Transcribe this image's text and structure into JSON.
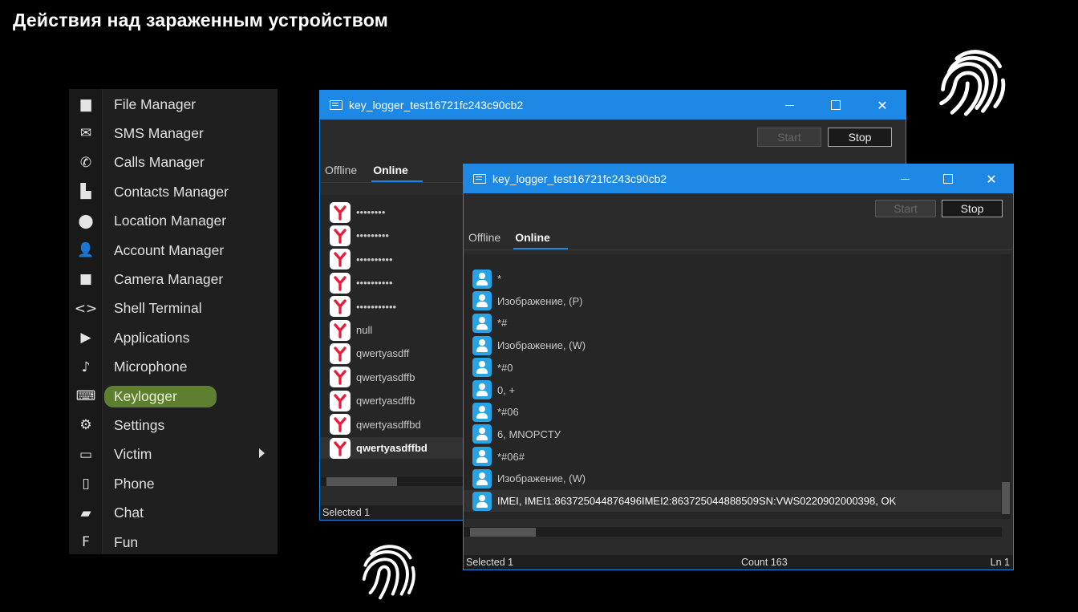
{
  "slide": {
    "title": "Действия над зараженным устройством"
  },
  "menu": {
    "items": [
      {
        "label": "File Manager",
        "icon": "folder-icon",
        "glyph": "▆"
      },
      {
        "label": "SMS Manager",
        "icon": "envelope-icon",
        "glyph": "✉"
      },
      {
        "label": "Calls Manager",
        "icon": "phone-handset-icon",
        "glyph": "✆"
      },
      {
        "label": "Contacts Manager",
        "icon": "contacts-book-icon",
        "glyph": "▙"
      },
      {
        "label": "Location Manager",
        "icon": "location-pin-icon",
        "glyph": "⬤"
      },
      {
        "label": "Account Manager",
        "icon": "person-icon",
        "glyph": "👤"
      },
      {
        "label": "Camera Manager",
        "icon": "video-camera-icon",
        "glyph": "■"
      },
      {
        "label": "Shell Terminal",
        "icon": "code-brackets-icon",
        "glyph": "<>"
      },
      {
        "label": "Applications",
        "icon": "play-store-icon",
        "glyph": "▶"
      },
      {
        "label": "Microphone",
        "icon": "microphone-icon",
        "glyph": "♪"
      },
      {
        "label": "Keylogger",
        "icon": "keyboard-icon",
        "glyph": "⌨"
      },
      {
        "label": "Settings",
        "icon": "gear-icon",
        "glyph": "⚙"
      },
      {
        "label": "Victim",
        "icon": "monitor-icon",
        "glyph": "▭"
      },
      {
        "label": "Phone",
        "icon": "smartphone-icon",
        "glyph": "▯"
      },
      {
        "label": "Chat",
        "icon": "chat-bubble-icon",
        "glyph": "▰"
      },
      {
        "label": "Fun",
        "icon": "fun-icon",
        "glyph": "F"
      }
    ],
    "active_index": 10,
    "accent": "#5e7f2f"
  },
  "window_back": {
    "title": "key_logger_test16721fc243c90cb2",
    "start_label": "Start",
    "stop_label": "Stop",
    "tabs": [
      "Offline",
      "Online"
    ],
    "active_tab": "Online",
    "items": [
      {
        "label": "••••••••",
        "icon": "yandex-browser-icon"
      },
      {
        "label": "•••••••••",
        "icon": "yandex-browser-icon"
      },
      {
        "label": "••••••••••",
        "icon": "yandex-browser-icon"
      },
      {
        "label": "••••••••••",
        "icon": "yandex-browser-icon"
      },
      {
        "label": "•••••••••••",
        "icon": "yandex-browser-icon"
      },
      {
        "label": "null",
        "icon": "yandex-browser-icon"
      },
      {
        "label": "qwertyasdff",
        "icon": "yandex-browser-icon"
      },
      {
        "label": "qwertyasdffb",
        "icon": "yandex-browser-icon"
      },
      {
        "label": "qwertyasdffb",
        "icon": "yandex-browser-icon"
      },
      {
        "label": "qwertyasdffbd",
        "icon": "yandex-browser-icon"
      },
      {
        "label": "qwertyasdffbd",
        "icon": "yandex-browser-icon"
      }
    ],
    "selected_index": 10,
    "status": {
      "selected": "Selected 1"
    }
  },
  "window_front": {
    "title": "key_logger_test16721fc243c90cb2",
    "start_label": "Start",
    "stop_label": "Stop",
    "tabs": [
      "Offline",
      "Online"
    ],
    "active_tab": "Online",
    "items": [
      {
        "label": "*",
        "icon": "contact-user-icon"
      },
      {
        "label": "Изображение, (P)",
        "icon": "contact-user-icon"
      },
      {
        "label": "*#",
        "icon": "contact-user-icon"
      },
      {
        "label": "Изображение, (W)",
        "icon": "contact-user-icon"
      },
      {
        "label": "*#0",
        "icon": "contact-user-icon"
      },
      {
        "label": "0, +",
        "icon": "contact-user-icon"
      },
      {
        "label": "*#06",
        "icon": "contact-user-icon"
      },
      {
        "label": "6, MNOPCTУ",
        "icon": "contact-user-icon"
      },
      {
        "label": "*#06#",
        "icon": "contact-user-icon"
      },
      {
        "label": "Изображение, (W)",
        "icon": "contact-user-icon"
      },
      {
        "label": "IMEI, IMEI1:863725044876496IMEI2:863725044888509SN:VWS0220902000398, OK",
        "icon": "contact-user-icon"
      }
    ],
    "selected_index": 10,
    "status": {
      "selected": "Selected 1",
      "count": "Count 163",
      "ln": "Ln 1"
    }
  },
  "colors": {
    "window_accent": "#1e88e5",
    "user_icon": "#27a3e6",
    "yandex_red": "#e61e3c"
  }
}
